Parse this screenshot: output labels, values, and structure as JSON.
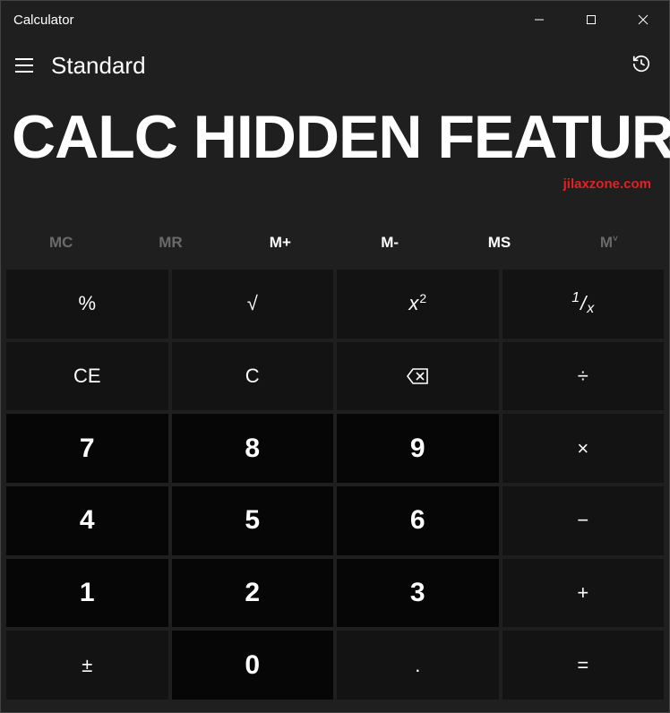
{
  "window": {
    "title": "Calculator"
  },
  "header": {
    "mode": "Standard"
  },
  "display": {
    "main": "CALC HIDDEN FEATURES",
    "watermark": "jilaxzone.com"
  },
  "memory": {
    "mc": "MC",
    "mr": "MR",
    "mplus": "M+",
    "mminus": "M-",
    "ms": "MS",
    "mlist": "M"
  },
  "keys": {
    "percent": "%",
    "sqrt": "√",
    "square_base": "x",
    "square_exp": "2",
    "recip_n": "1",
    "recip_d": "x",
    "ce": "CE",
    "c": "C",
    "divide": "÷",
    "multiply": "×",
    "minus": "−",
    "plus": "+",
    "equals": "=",
    "negate": "±",
    "decimal": ".",
    "n0": "0",
    "n1": "1",
    "n2": "2",
    "n3": "3",
    "n4": "4",
    "n5": "5",
    "n6": "6",
    "n7": "7",
    "n8": "8",
    "n9": "9"
  }
}
